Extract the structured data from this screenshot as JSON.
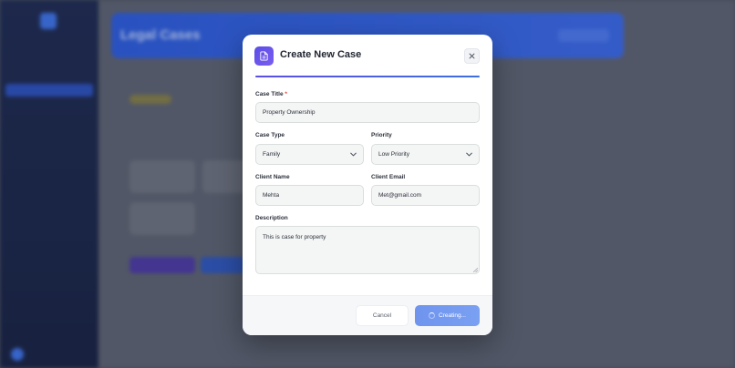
{
  "background": {
    "hero_title": "Legal Cases",
    "accent_color": "#2d5ad6"
  },
  "modal": {
    "title": "Create New Case",
    "icon": "document-icon",
    "close_icon": "close-icon",
    "fields": {
      "case_title": {
        "label": "Case Title",
        "required_mark": "*",
        "value": "Property Ownership"
      },
      "case_type": {
        "label": "Case Type",
        "value": "Family"
      },
      "priority": {
        "label": "Priority",
        "value": "Low Priority"
      },
      "client_name": {
        "label": "Client Name",
        "value": "Mehta"
      },
      "client_email": {
        "label": "Client Email",
        "value": "Met@gmail.com"
      },
      "description": {
        "label": "Description",
        "value": "This is case for property"
      }
    },
    "footer": {
      "cancel_label": "Cancel",
      "submit_label": "Creating..."
    },
    "colors": {
      "icon_gradient_start": "#5b4ee6",
      "submit_button": "#7aa0f2",
      "required": "#e0413a"
    }
  }
}
